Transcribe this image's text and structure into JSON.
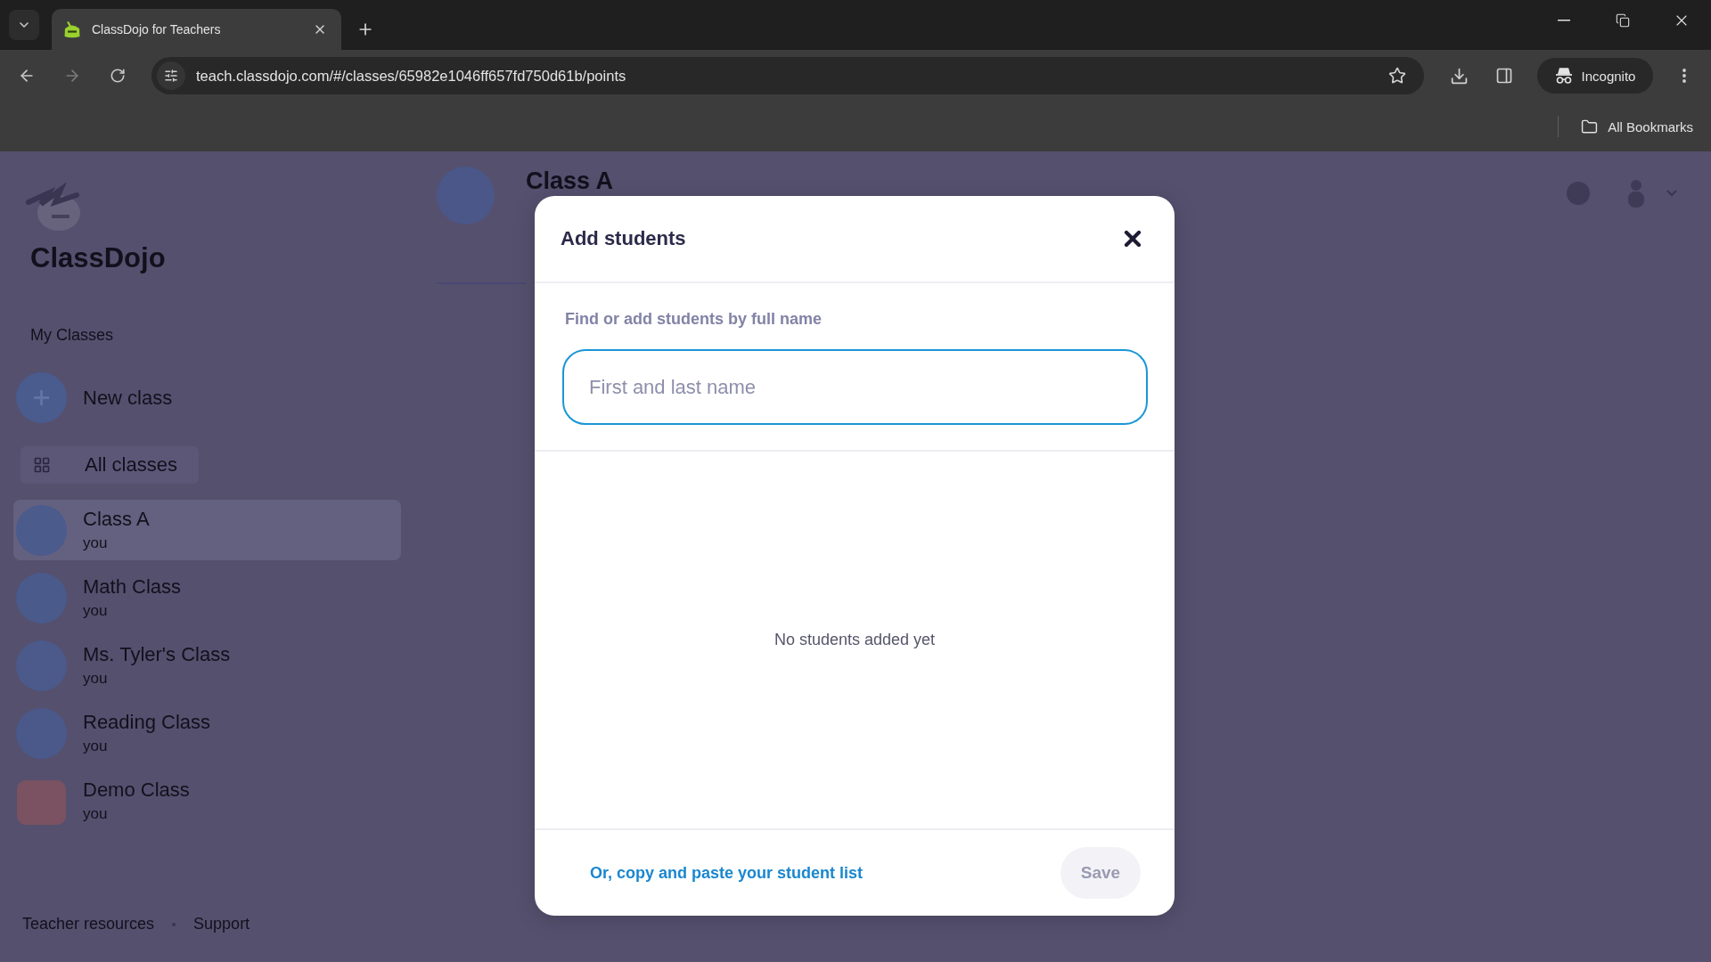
{
  "browser": {
    "tabs": [
      {
        "title": "ClassDojo for Teachers",
        "selected": true
      }
    ],
    "forward_enabled": false,
    "url": "teach.classdojo.com/#/classes/65982e1046ff657fd750d61b/points",
    "profile": "Incognito",
    "bookmarks_folder": "All Bookmarks"
  },
  "sidebar": {
    "brand": "ClassDojo",
    "section_title": "My Classes",
    "new_class": "New class",
    "all_classes": "All classes",
    "classes": [
      {
        "name": "Class A",
        "owner": "you",
        "kind": "class",
        "color": "#4a5b8c",
        "selected": true
      },
      {
        "name": "Math Class",
        "owner": "you",
        "kind": "class",
        "color": "#4a5a8b",
        "selected": false
      },
      {
        "name": "Ms. Tyler's Class",
        "owner": "you",
        "kind": "class",
        "color": "#4b5a8a",
        "selected": false
      },
      {
        "name": "Reading Class",
        "owner": "you",
        "kind": "class",
        "color": "#4a598a",
        "selected": false
      },
      {
        "name": "Demo Class",
        "owner": "you",
        "kind": "demo",
        "color": "#7a5262",
        "selected": false
      }
    ],
    "footer_links": [
      "Teacher resources",
      "Support"
    ]
  },
  "class_header": {
    "title": "Class A"
  },
  "dialog": {
    "title": "Add students",
    "field_label": "Find or add students by full name",
    "name_field": {
      "placeholder": "First and last name",
      "focused": true
    },
    "empty_message": "No students added yet",
    "paste_link": "Or, copy and paste your student list",
    "save_button": {
      "label": "Save",
      "disabled": true
    }
  }
}
